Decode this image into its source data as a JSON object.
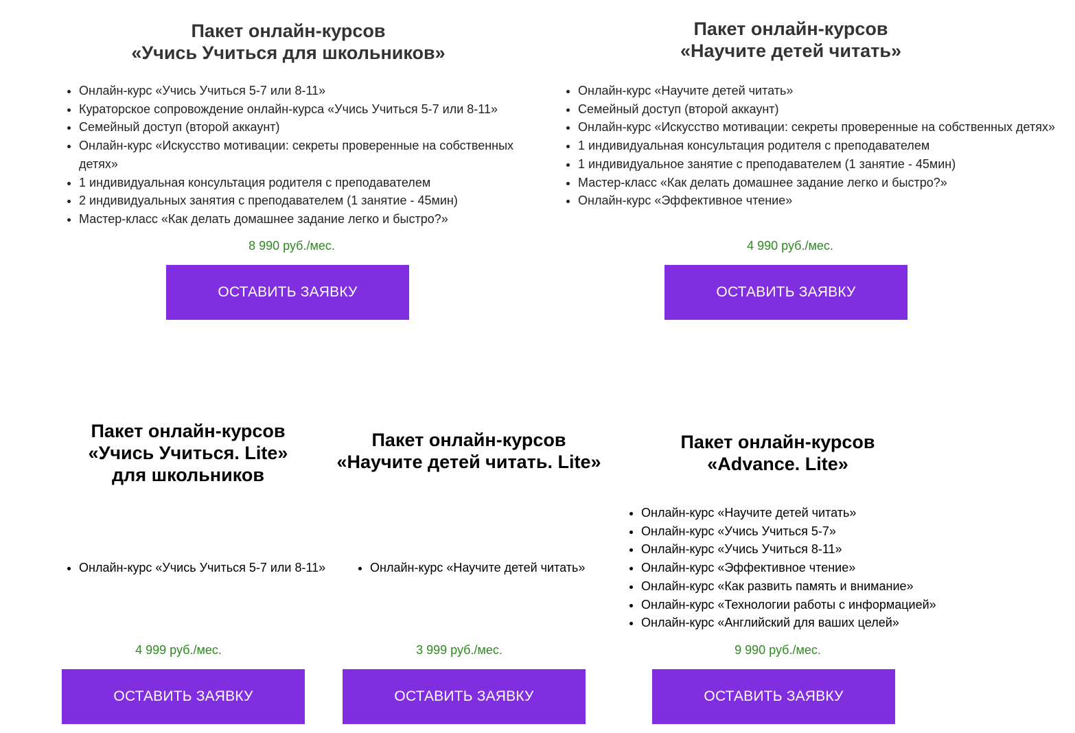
{
  "colors": {
    "button_bg": "#812ee0",
    "button_text": "#ffffff",
    "price": "#2d8a1f",
    "title": "#333333"
  },
  "packages": [
    {
      "title_line1": "Пакет онлайн-курсов",
      "title_line2": "«Учись Учиться для школьников»",
      "features": [
        "Онлайн-курс «Учись Учиться 5-7 или 8-11»",
        "Кураторское сопровождение онлайн-курса «Учись Учиться 5-7 или 8-11»",
        "Семейный доступ (второй аккаунт)",
        "Онлайн-курс «Искусство мотивации: секреты проверенные на собственных детях»",
        "1 индивидуальная консультация родителя с преподавателем",
        "2 индивидуальных занятия с преподавателем (1 занятие - 45мин)",
        "Мастер-класс «Как делать домашнее задание легко и быстро?»"
      ],
      "price": "8 990 руб./мес.",
      "button_label": "ОСТАВИТЬ ЗАЯВКУ"
    },
    {
      "title_line1": "Пакет онлайн-курсов",
      "title_line2": "«Научите детей читать»",
      "features": [
        "Онлайн-курс «Научите детей читать»",
        "Семейный доступ (второй аккаунт)",
        "Онлайн-курс «Искусство мотивации: секреты проверенные на собственных детях»",
        "1 индивидуальная консультация родителя с преподавателем",
        "1 индивидуальное занятие с преподавателем (1 занятие - 45мин)",
        "Мастер-класс «Как делать домашнее задание легко и быстро?»",
        "Онлайн-курс «Эффективное чтение»"
      ],
      "price": "4 990 руб./мес.",
      "button_label": "ОСТАВИТЬ ЗАЯВКУ"
    },
    {
      "title_line1": "Пакет онлайн-курсов",
      "title_line2": "«Учись Учиться. Lite»",
      "title_line3": "для школьников",
      "features": [
        "Онлайн-курс «Учись Учиться 5-7 или 8-11»"
      ],
      "price": "4 999 руб./мес.",
      "button_label": "ОСТАВИТЬ ЗАЯВКУ"
    },
    {
      "title_line1": "Пакет онлайн-курсов",
      "title_line2": "«Научите детей читать. Lite»",
      "features": [
        "Онлайн-курс «Научите детей читать»"
      ],
      "price": "3 999 руб./мес.",
      "button_label": "ОСТАВИТЬ ЗАЯВКУ"
    },
    {
      "title_line1": "Пакет онлайн-курсов",
      "title_line2": "«Advance. Lite»",
      "features": [
        "Онлайн-курс «Научите детей читать»",
        "Онлайн-курс «Учись Учиться 5-7»",
        "Онлайн-курс «Учись Учиться 8-11»",
        "Онлайн-курс «Эффективное чтение»",
        "Онлайн-курс «Как развить память и внимание»",
        "Онлайн-курс «Технологии работы с информацией»",
        "Онлайн-курс «Английский для ваших целей»"
      ],
      "price": "9 990 руб./мес.",
      "button_label": "ОСТАВИТЬ ЗАЯВКУ"
    }
  ]
}
